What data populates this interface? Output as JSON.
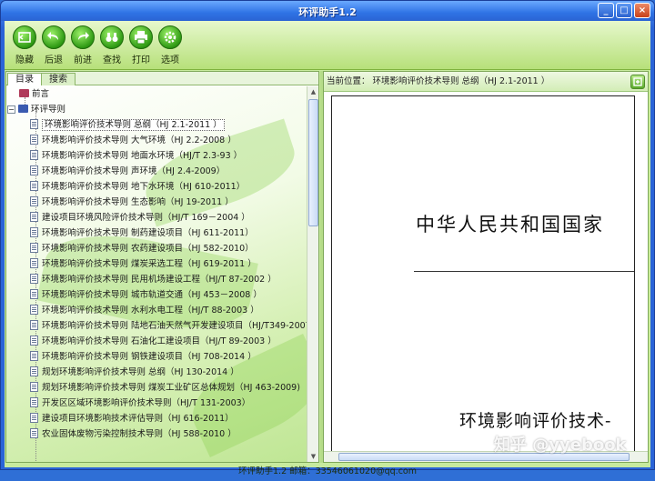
{
  "window": {
    "title": "环评助手1.2",
    "controls": [
      "_",
      "□",
      "×"
    ]
  },
  "toolbar": [
    {
      "label": "隐藏",
      "icon": "hide-icon"
    },
    {
      "label": "后退",
      "icon": "back-icon"
    },
    {
      "label": "前进",
      "icon": "forward-icon"
    },
    {
      "label": "查找",
      "icon": "binoculars-icon"
    },
    {
      "label": "打印",
      "icon": "printer-icon"
    },
    {
      "label": "选项",
      "icon": "gear-icon"
    }
  ],
  "tabs": [
    "目录",
    "搜索"
  ],
  "tree": {
    "preface": "前言",
    "folder": "环评导则",
    "items": [
      "环境影响评价技术导则 总纲（HJ 2.1-2011 ）",
      "环境影响评价技术导则 大气环境（HJ 2.2-2008 ）",
      "环境影响评价技术导则 地面水环境（HJ/T 2.3-93 ）",
      "环境影响评价技术导则 声环境（HJ 2.4-2009）",
      "环境影响评价技术导则 地下水环境（HJ 610-2011）",
      "环境影响评价技术导则 生态影响（HJ 19-2011 ）",
      "建设项目环境风险评价技术导则（HJ/T 169－2004 ）",
      "环境影响评价技术导则 制药建设项目（HJ 611-2011）",
      "环境影响评价技术导则 农药建设项目（HJ 582-2010）",
      "环境影响评价技术导则 煤炭采选工程（HJ 619-2011 ）",
      "环境影响评价技术导则 民用机场建设工程（HJ/T 87-2002 ）",
      "环境影响评价技术导则 城市轨道交通（HJ 453－2008 ）",
      "环境影响评价技术导则 水利水电工程（HJ/T 88-2003 ）",
      "环境影响评价技术导则 陆地石油天然气开发建设项目（HJ/T349-2007)",
      "环境影响评价技术导则 石油化工建设项目（HJ/T 89-2003 ）",
      "环境影响评价技术导则 钢铁建设项目（HJ 708-2014 ）",
      "规划环境影响评价技术导则 总纲（HJ 130-2014 ）",
      "规划环境影响评价技术导则 煤炭工业矿区总体规划（HJ 463-2009)",
      "开发区区域环境影响评价技术导则（HJ/T 131-2003）",
      "建设项目环境影响技术评估导则（HJ 616-2011）",
      "农业固体废物污染控制技术导则（HJ 588-2010 ）"
    ],
    "selected_index": 0
  },
  "location": "当前位置：  环境影响评价技术导则 总纲（HJ 2.1-2011 ）",
  "document": {
    "heading": "中华人民共和国国家",
    "subheading": "环境影响评价技术-"
  },
  "status": "环评助手1.2    邮箱：33546061020@qq.com",
  "watermark": "知乎 @yyebook"
}
